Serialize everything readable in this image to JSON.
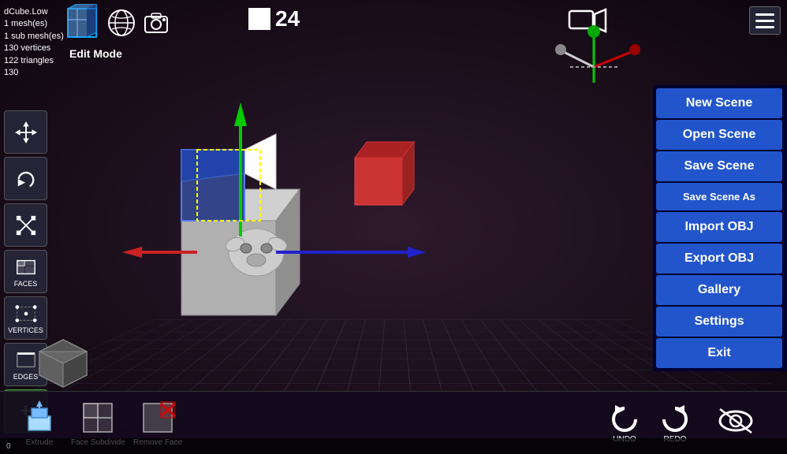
{
  "viewport": {
    "background": "#1a0a1a"
  },
  "info_panel": {
    "line1": "dCube.Low",
    "line2": "1 mesh(es)",
    "line3": "1 sub mesh(es)",
    "line4": "130 vertices",
    "line5": "122 triangles",
    "line6": "130"
  },
  "mode": {
    "label": "Edit Mode"
  },
  "frame": {
    "number": "24"
  },
  "left_toolbar": {
    "faces_label": "FACES",
    "vertices_label": "VERTICES",
    "edges_label": "EDGES",
    "add_label": "+"
  },
  "right_menu": {
    "buttons": [
      {
        "id": "new-scene",
        "label": "New Scene"
      },
      {
        "id": "open-scene",
        "label": "Open Scene"
      },
      {
        "id": "save-scene",
        "label": "Save Scene"
      },
      {
        "id": "save-scene-as",
        "label": "Save Scene As"
      },
      {
        "id": "import-obj",
        "label": "Import OBJ"
      },
      {
        "id": "export-obj",
        "label": "Export OBJ"
      },
      {
        "id": "gallery",
        "label": "Gallery"
      },
      {
        "id": "settings",
        "label": "Settings"
      },
      {
        "id": "exit",
        "label": "Exit"
      }
    ]
  },
  "bottom_toolbar": {
    "tools": [
      {
        "id": "extrude",
        "label": "Extrude"
      },
      {
        "id": "face-subdivide",
        "label": "Face Subdivide"
      },
      {
        "id": "remove-face",
        "label": "Remove Face"
      }
    ],
    "undo_label": "UNDO",
    "redo_label": "REDO"
  },
  "status_bar": {
    "text": "0"
  }
}
